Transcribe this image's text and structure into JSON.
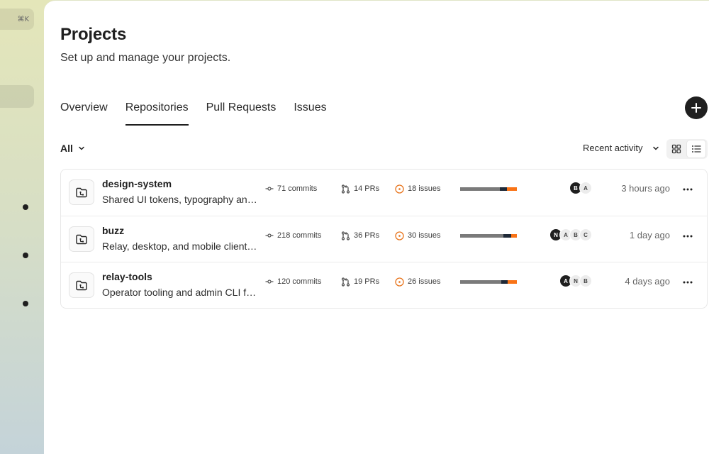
{
  "sidebar": {
    "shortcut": "⌘K",
    "nav_icons": [
      "dot-icon",
      "dot-icon",
      "dot-icon"
    ]
  },
  "header": {
    "title": "Projects",
    "subtitle": "Set up and manage your projects."
  },
  "tabs": [
    {
      "label": "Overview",
      "active": false
    },
    {
      "label": "Repositories",
      "active": true
    },
    {
      "label": "Pull Requests",
      "active": false
    },
    {
      "label": "Issues",
      "active": false
    }
  ],
  "toolbar": {
    "add_icon": "plus-icon",
    "filter_label": "All",
    "sort_label": "Recent activity",
    "view_modes": [
      "grid-icon",
      "list-icon"
    ],
    "active_view": "list"
  },
  "colors": {
    "bar_gray": "#7a7a7a",
    "bar_dark": "#1f2937",
    "bar_orange": "#f97316",
    "issue_icon": "#e8741c"
  },
  "repos": [
    {
      "name": "design-system",
      "description": "Shared UI tokens, typography and components",
      "commits": "71 commits",
      "prs": "14 PRs",
      "issues": "18 issues",
      "bar": {
        "gray": 0.7,
        "dark": 0.12,
        "orange": 0.18
      },
      "avatars": [
        {
          "initial": "B",
          "dark": true
        },
        {
          "initial": "A",
          "dark": false
        }
      ],
      "updated": "3 hours ago"
    },
    {
      "name": "buzz",
      "description": "Relay, desktop, and mobile clients for buzz",
      "commits": "218 commits",
      "prs": "36 PRs",
      "issues": "30 issues",
      "bar": {
        "gray": 0.76,
        "dark": 0.14,
        "orange": 0.1
      },
      "avatars": [
        {
          "initial": "N",
          "dark": true
        },
        {
          "initial": "A",
          "dark": false
        },
        {
          "initial": "B",
          "dark": false
        },
        {
          "initial": "C",
          "dark": false
        }
      ],
      "updated": "1 day ago"
    },
    {
      "name": "relay-tools",
      "description": "Operator tooling and admin CLI for relays",
      "commits": "120 commits",
      "prs": "19 PRs",
      "issues": "26 issues",
      "bar": {
        "gray": 0.72,
        "dark": 0.12,
        "orange": 0.16
      },
      "avatars": [
        {
          "initial": "A",
          "dark": true
        },
        {
          "initial": "N",
          "dark": false
        },
        {
          "initial": "B",
          "dark": false
        }
      ],
      "updated": "4 days ago"
    }
  ]
}
